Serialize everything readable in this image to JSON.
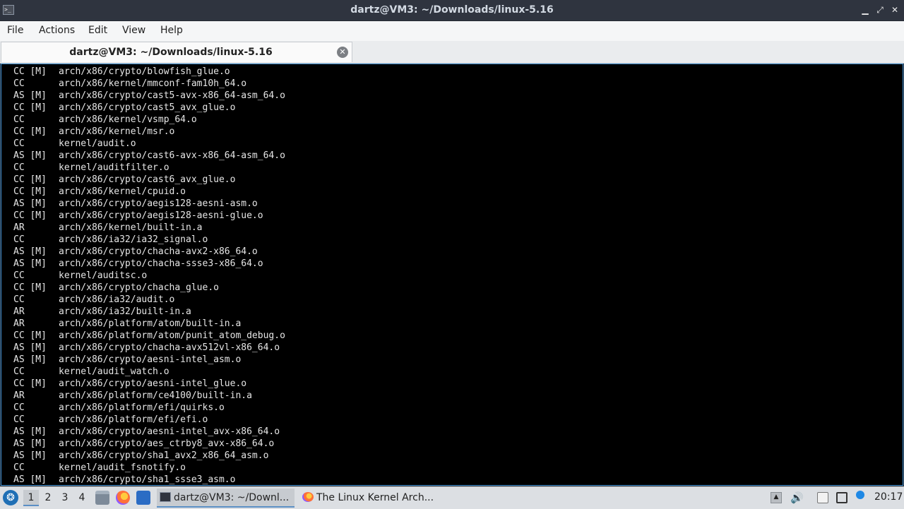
{
  "window": {
    "title": "dartz@VM3: ~/Downloads/linux-5.16",
    "app_icon": "terminal-icon"
  },
  "menubar": [
    "File",
    "Actions",
    "Edit",
    "View",
    "Help"
  ],
  "tab": {
    "label": "dartz@VM3: ~/Downloads/linux-5.16"
  },
  "terminal_lines": [
    {
      "cmd": "CC [M]",
      "path": "arch/x86/crypto/blowfish_glue.o"
    },
    {
      "cmd": "CC",
      "path": "arch/x86/kernel/mmconf-fam10h_64.o"
    },
    {
      "cmd": "AS [M]",
      "path": "arch/x86/crypto/cast5-avx-x86_64-asm_64.o"
    },
    {
      "cmd": "CC [M]",
      "path": "arch/x86/crypto/cast5_avx_glue.o"
    },
    {
      "cmd": "CC",
      "path": "arch/x86/kernel/vsmp_64.o"
    },
    {
      "cmd": "CC [M]",
      "path": "arch/x86/kernel/msr.o"
    },
    {
      "cmd": "CC",
      "path": "kernel/audit.o"
    },
    {
      "cmd": "AS [M]",
      "path": "arch/x86/crypto/cast6-avx-x86_64-asm_64.o"
    },
    {
      "cmd": "CC",
      "path": "kernel/auditfilter.o"
    },
    {
      "cmd": "CC [M]",
      "path": "arch/x86/crypto/cast6_avx_glue.o"
    },
    {
      "cmd": "CC [M]",
      "path": "arch/x86/kernel/cpuid.o"
    },
    {
      "cmd": "AS [M]",
      "path": "arch/x86/crypto/aegis128-aesni-asm.o"
    },
    {
      "cmd": "CC [M]",
      "path": "arch/x86/crypto/aegis128-aesni-glue.o"
    },
    {
      "cmd": "AR",
      "path": "arch/x86/kernel/built-in.a"
    },
    {
      "cmd": "CC",
      "path": "arch/x86/ia32/ia32_signal.o"
    },
    {
      "cmd": "AS [M]",
      "path": "arch/x86/crypto/chacha-avx2-x86_64.o"
    },
    {
      "cmd": "AS [M]",
      "path": "arch/x86/crypto/chacha-ssse3-x86_64.o"
    },
    {
      "cmd": "CC",
      "path": "kernel/auditsc.o"
    },
    {
      "cmd": "CC [M]",
      "path": "arch/x86/crypto/chacha_glue.o"
    },
    {
      "cmd": "CC",
      "path": "arch/x86/ia32/audit.o"
    },
    {
      "cmd": "AR",
      "path": "arch/x86/ia32/built-in.a"
    },
    {
      "cmd": "AR",
      "path": "arch/x86/platform/atom/built-in.a"
    },
    {
      "cmd": "CC [M]",
      "path": "arch/x86/platform/atom/punit_atom_debug.o"
    },
    {
      "cmd": "AS [M]",
      "path": "arch/x86/crypto/chacha-avx512vl-x86_64.o"
    },
    {
      "cmd": "AS [M]",
      "path": "arch/x86/crypto/aesni-intel_asm.o"
    },
    {
      "cmd": "CC",
      "path": "kernel/audit_watch.o"
    },
    {
      "cmd": "CC [M]",
      "path": "arch/x86/crypto/aesni-intel_glue.o"
    },
    {
      "cmd": "AR",
      "path": "arch/x86/platform/ce4100/built-in.a"
    },
    {
      "cmd": "CC",
      "path": "arch/x86/platform/efi/quirks.o"
    },
    {
      "cmd": "CC",
      "path": "arch/x86/platform/efi/efi.o"
    },
    {
      "cmd": "AS [M]",
      "path": "arch/x86/crypto/aesni-intel_avx-x86_64.o"
    },
    {
      "cmd": "AS [M]",
      "path": "arch/x86/crypto/aes_ctrby8_avx-x86_64.o"
    },
    {
      "cmd": "AS [M]",
      "path": "arch/x86/crypto/sha1_avx2_x86_64_asm.o"
    },
    {
      "cmd": "CC",
      "path": "kernel/audit_fsnotify.o"
    },
    {
      "cmd": "AS [M]",
      "path": "arch/x86/crypto/sha1_ssse3_asm.o"
    }
  ],
  "taskbar": {
    "workspaces": [
      "1",
      "2",
      "3",
      "4"
    ],
    "active_workspace": "1",
    "tasks": [
      {
        "label": "dartz@VM3: ~/Downl...",
        "icon": "terminal-icon"
      },
      {
        "label": "The Linux Kernel Arch...",
        "icon": "firefox-icon"
      }
    ],
    "clock": "20:17"
  }
}
